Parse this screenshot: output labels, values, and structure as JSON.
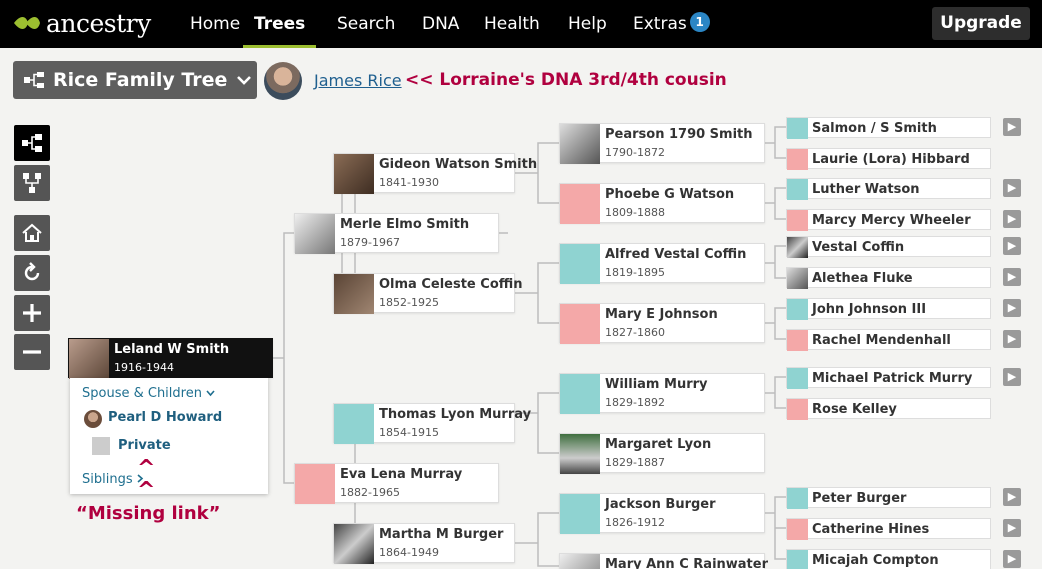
{
  "nav": {
    "logo": "ancestry",
    "items": [
      "Home",
      "Trees",
      "Search",
      "DNA",
      "Health",
      "Help",
      "Extras"
    ],
    "extras_badge": "1",
    "upgrade": "Upgrade"
  },
  "tree": {
    "selector": "Rice Family Tree",
    "home_person": "James Rice",
    "annotation": "<< Lorraine's DNA 3rd/4th cousin"
  },
  "root": {
    "name": "Leland W Smith",
    "dates": "1916-1944"
  },
  "panel": {
    "spouse_label": "Spouse & Children",
    "spouse": "Pearl D Howard",
    "child": "Private",
    "siblings_label": "Siblings"
  },
  "annotations": {
    "missing_link": "“Missing link”",
    "caret": "^"
  },
  "gen1": [
    {
      "name": "Merle Elmo Smith",
      "dates": "1879-1967"
    },
    {
      "name": "Eva Lena Murray",
      "dates": "1882-1965"
    }
  ],
  "gen2": [
    {
      "name": "Gideon Watson Smith",
      "dates": "1841-1930"
    },
    {
      "name": "Olma Celeste Coffin",
      "dates": "1852-1925"
    },
    {
      "name": "Thomas Lyon Murray",
      "dates": "1854-1915"
    },
    {
      "name": "Martha M Burger",
      "dates": "1864-1949"
    }
  ],
  "gen3": [
    {
      "name": "Pearson 1790 Smith",
      "dates": "1790-1872"
    },
    {
      "name": "Phoebe G Watson",
      "dates": "1809-1888"
    },
    {
      "name": "Alfred Vestal Coffin",
      "dates": "1819-1895"
    },
    {
      "name": "Mary E Johnson",
      "dates": "1827-1860"
    },
    {
      "name": "William Murry",
      "dates": "1829-1892"
    },
    {
      "name": "Margaret Lyon",
      "dates": "1829-1887"
    },
    {
      "name": "Jackson Burger",
      "dates": "1826-1912"
    },
    {
      "name": "Mary Ann C Rainwater",
      "dates": ""
    }
  ],
  "gen4": [
    "Salmon / S Smith",
    "Laurie (Lora) Hibbard",
    "Luther Watson",
    "Marcy Mercy Wheeler",
    "Vestal Coffin",
    "Alethea Fluke",
    "John Johnson III",
    "Rachel Mendenhall",
    "Michael Patrick Murry",
    "Rose Kelley",
    "Peter Burger",
    "Catherine Hines",
    "Micajah Compton"
  ],
  "colors": {
    "male": "#8fd3d1",
    "female": "#f4a8a8",
    "accent": "#9cbe30",
    "annotation": "#b0003f"
  }
}
